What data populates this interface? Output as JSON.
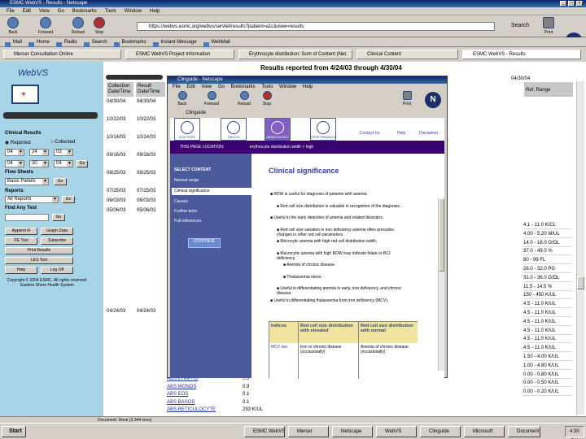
{
  "window": {
    "title": "ESMC WebVS - Results - Netscape"
  },
  "menu": [
    "File",
    "Edit",
    "View",
    "Go",
    "Bookmarks",
    "Tools",
    "Window",
    "Help"
  ],
  "nav": {
    "back": "Back",
    "forward": "Forward",
    "reload": "Reload",
    "stop": "Stop",
    "search": "Search",
    "print": "Print",
    "url": "https://webvs.esmc.org/webvs/servlet/results?patient=a1c&view=results"
  },
  "bookmarks": [
    "Mail",
    "Home",
    "Radio",
    "Search",
    "Bookmarks",
    "Instant Message",
    "WebMail"
  ],
  "page_tabs": [
    "Mercer Consultation Online",
    "ESMC WebVS Project Information",
    "Erythrocyte distribution: Sum of Content (Net.",
    "Clinical Content",
    "ESMC WebVS - Results"
  ],
  "left": {
    "logo": "WebVS",
    "clinical_results": "Clinical Results",
    "reported": "Reported",
    "collected": "Collected",
    "date1": [
      "04",
      "24",
      "03"
    ],
    "date2": [
      "04",
      "30",
      "04"
    ],
    "flow_sheets": "Flow Sheets",
    "flow_value": "Basic Panels",
    "go": "Go",
    "reports": "Reports",
    "reports_value": "All Reports",
    "find_any_test": "Find Any Test",
    "buttons": [
      "Append Fl",
      "Graph Data",
      "PE Tool",
      "Subscribe",
      "Print Results",
      "LES Tool",
      "Help",
      "Log Off"
    ],
    "footer": "Copyright © 2004 ESMC. All rights reserved. Eastern Shore Health System"
  },
  "results": {
    "title": "Results reported from 4/24/03 through 4/30/04",
    "col_collection": "Collection Date/Time",
    "col_result": "Result Date/Time",
    "ref_range": "Ref. Range",
    "rows": [
      [
        "04/30/04",
        "04/30/04"
      ],
      [
        "10/22/03",
        "10/22/03"
      ],
      [
        "10/14/03",
        "10/14/03"
      ],
      [
        "09/16/03",
        "09/16/03"
      ],
      [
        "08/25/03",
        "08/25/03"
      ],
      [
        "07/25/03",
        "07/25/03"
      ],
      [
        "06/03/03",
        "06/03/03"
      ],
      [
        "05/06/03",
        "05/06/03"
      ],
      [
        "04/24/03",
        "04/24/03"
      ]
    ],
    "ref_values": [
      "4.1 - 11.0 K/CL",
      "4.00 - 5.20 M/UL",
      "14.0 - 18.0 G/DL",
      "37.0 - 49.0 %",
      "80 - 99 FL",
      "26.0 - 32.0 PG",
      "31.0 - 36.0 G/DL",
      "11.5 - 14.5 %",
      "150 - 450 K/UL",
      "4.5 - 11.0 K/UL",
      "4.5 - 11.0 K/UL",
      "4.5 - 11.0 K/UL",
      "4.5 - 11.0 K/UL",
      "4.5 - 11.0 K/UL",
      "4.5 - 11.0 K/UL",
      "1.50 - 4.00 K/UL",
      "1.00 - 4.80 K/UL",
      "0.00 - 0.80 K/UL",
      "0.00 - 0.50 K/UL",
      "0.00 - 0.20 K/UL"
    ],
    "bottom_rows": [
      [
        "ABS LYMPHS",
        "5.3"
      ],
      [
        "ABS MONOS",
        "0.9"
      ],
      [
        "ABS EOS",
        "0.1"
      ],
      [
        "ABS BASOS",
        "0.1"
      ],
      [
        "ABS RETICULOCYTE",
        "293 K/UL"
      ]
    ]
  },
  "popup": {
    "title": "Clinguide - Netscape",
    "menu": [
      "File",
      "Edit",
      "View",
      "Go",
      "Bookmarks",
      "Tools",
      "Window",
      "Help"
    ],
    "tabs": [
      "DOCTORS",
      "DRUGS",
      "HEMATOLOGY",
      "PERFORMANCE"
    ],
    "right_links": [
      "Contact Us",
      "Help",
      "Disclaimer"
    ],
    "location_label": "THIS PAGE LOCATION:",
    "location_value": "erythrocyte distribution width > high",
    "side_header": "SELECT CONTENT",
    "side_items": [
      "Normal range",
      "Clinical significance",
      "Causes",
      "Further tests",
      "Full references"
    ],
    "side_button": "CONTINUE",
    "heading": "Clinical significance",
    "bullets": [
      "RDW is useful for diagnosis of patients with anemia.",
      "Red cell size distribution is valuable in recognition of the diagnosis.",
      "Useful in the early detection of anemia and related disorders.",
      "Red cell size variation in iron deficiency anemia often precedes changes in other red cell parameters.",
      "Microcytic anemia with high red cell distribution width.",
      "Macrocytic anemia with high RDW may indicate folate or B12 deficiency.",
      "Anemia of chronic disease.",
      "Thalassemia minor.",
      "Useful in differentiating anemia in early, iron deficiency, and chronic disease.",
      "Useful in differentiating thalassemia from iron deficiency (MCV)."
    ],
    "table_headers": [
      "Indices",
      "Red cell size distribution with elevated",
      "Red cell size distribution with normal"
    ],
    "table_row": [
      "MCV low",
      "Iron or chronic disease (occasionally)",
      "Anemia of chronic disease (occasionally)"
    ]
  },
  "status": "Document: Done (2.344 secs)",
  "taskbar": {
    "start": "Start",
    "items": [
      "ESMC WebVS",
      "Mercer",
      "Netscape",
      "WebVS",
      "Clinguide",
      "Microsoft",
      "Document"
    ],
    "clock": "4:30 PM"
  }
}
